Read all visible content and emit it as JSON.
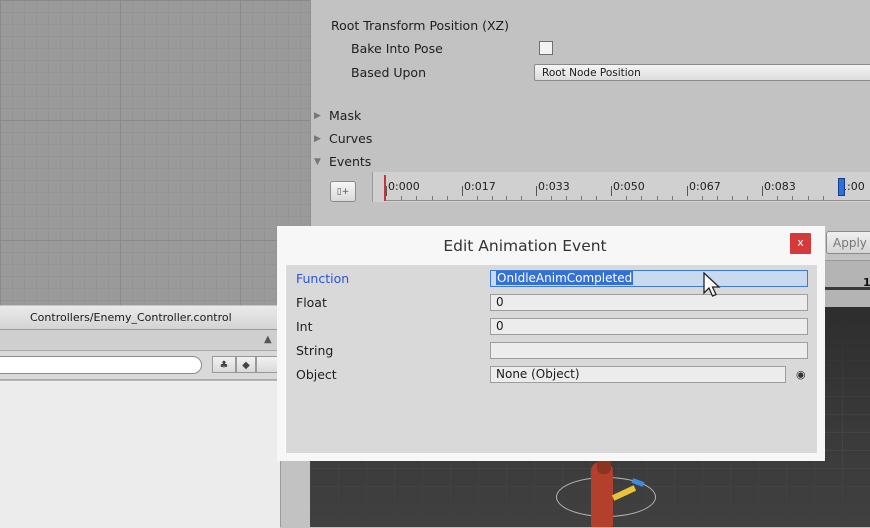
{
  "left": {
    "path": "Controllers/Enemy_Controller.control",
    "toolbar_icon1": "♣",
    "toolbar_icon2": "◆"
  },
  "inspector": {
    "root_transform_label": "Root Transform Position (XZ)",
    "bake_into_pose_label": "Bake Into Pose",
    "based_upon_label": "Based Upon",
    "based_upon_value": "Root Node Position",
    "sections": [
      "Mask",
      "Curves",
      "Events"
    ],
    "apply_label": "Apply",
    "slider_value": "1"
  },
  "timeline": {
    "ticks": [
      "0:000",
      "0:017",
      "0:033",
      "0:050",
      "0:067",
      "0:083",
      "1:00"
    ]
  },
  "dialog": {
    "title": "Edit Animation Event",
    "close_label": "x",
    "fields": {
      "function_label": "Function",
      "function_value": "OnIdleAnimCompleted",
      "float_label": "Float",
      "float_value": "0",
      "int_label": "Int",
      "int_value": "0",
      "string_label": "String",
      "string_value": "",
      "object_label": "Object",
      "object_value": "None (Object)"
    }
  },
  "colors": {
    "accent_blue": "#3571d4",
    "close_red": "#d43a3a",
    "timeline_red": "#c8323a"
  }
}
